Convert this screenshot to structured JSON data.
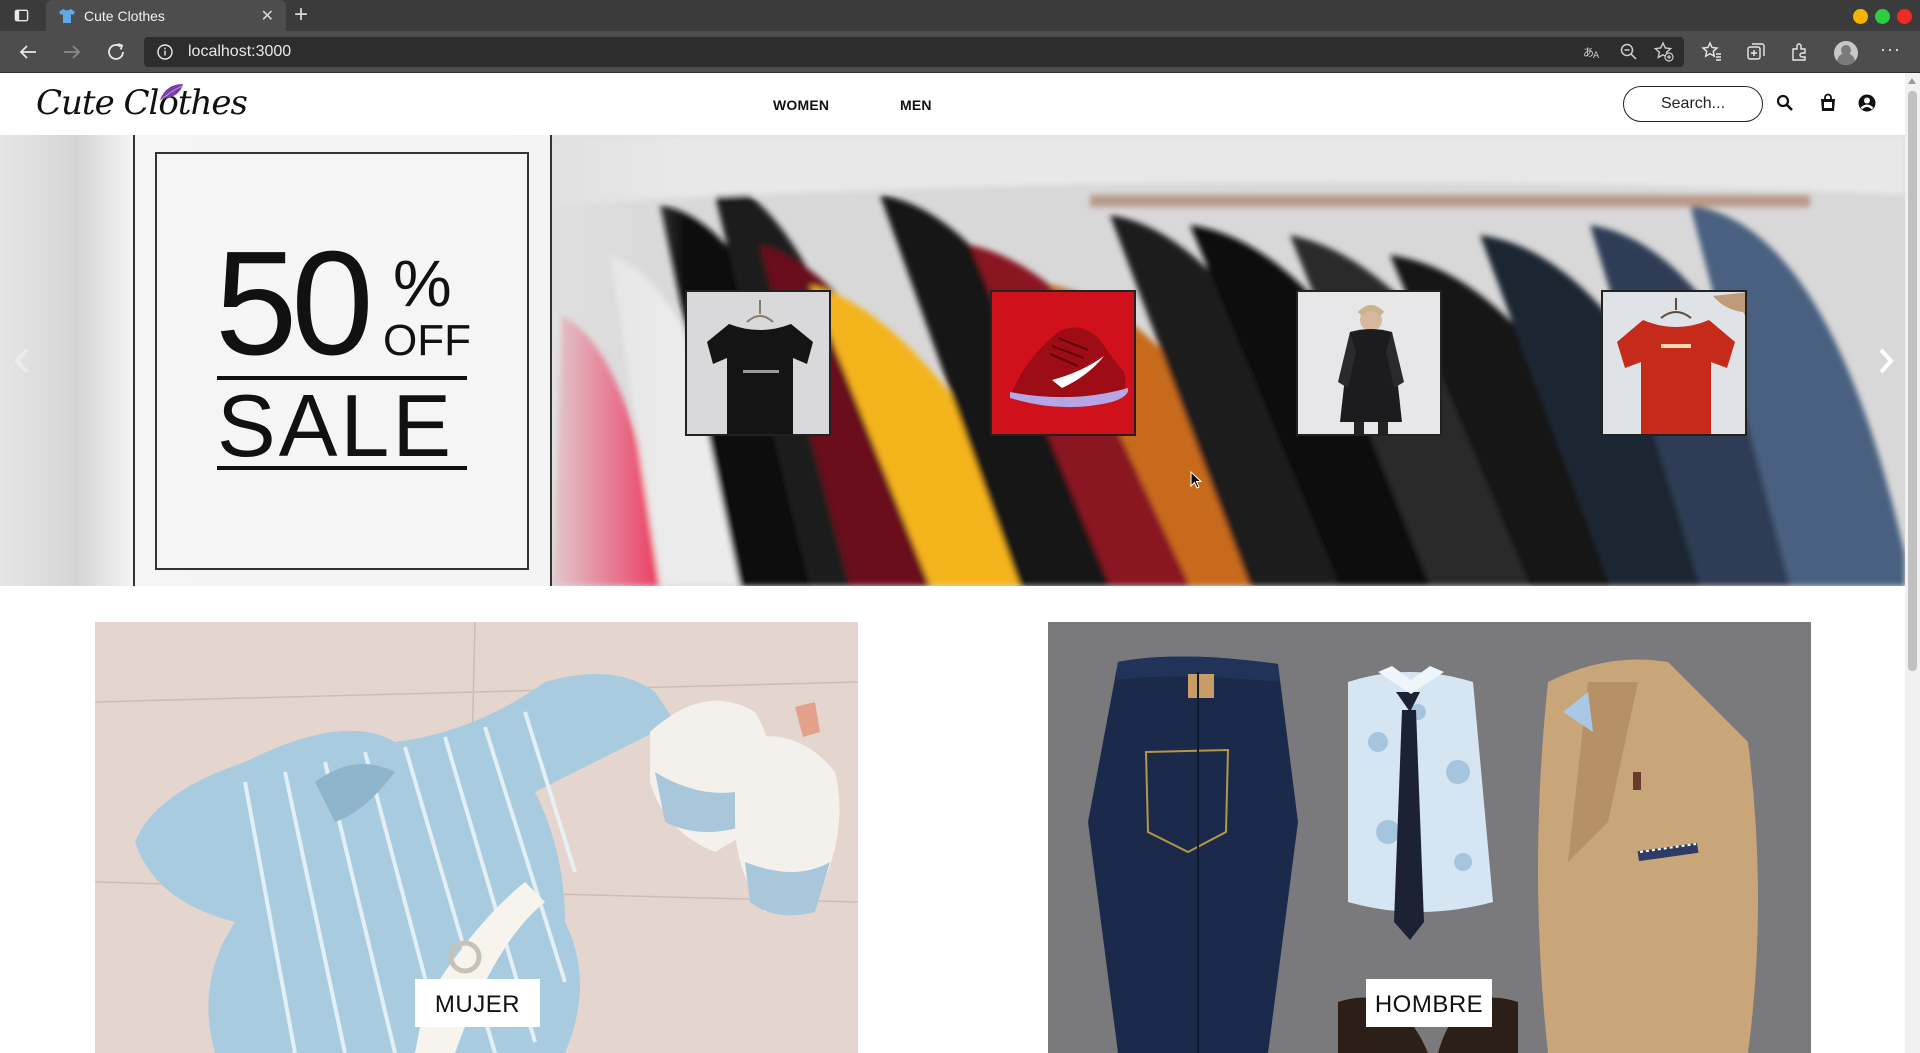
{
  "browser": {
    "tab_title": "Cute Clothes",
    "url": "localhost:3000"
  },
  "site": {
    "logo_text": "Cute Clothes",
    "nav": {
      "women": "WOMEN",
      "men": "MEN"
    },
    "search_placeholder": "Search..."
  },
  "hero": {
    "sale": {
      "big": "50",
      "percent": "%",
      "off": "OFF",
      "word": "SALE"
    },
    "thumbnails": [
      "black-tshirt",
      "red-sneaker",
      "black-parka",
      "red-tshirt"
    ]
  },
  "categories": {
    "women": "MUJER",
    "men": "HOMBRE"
  },
  "colors": {
    "chrome_dark": "#3b3b3b",
    "chrome_mid": "#4d4d4d",
    "accent_red": "#d0101b",
    "text": "#111111"
  }
}
